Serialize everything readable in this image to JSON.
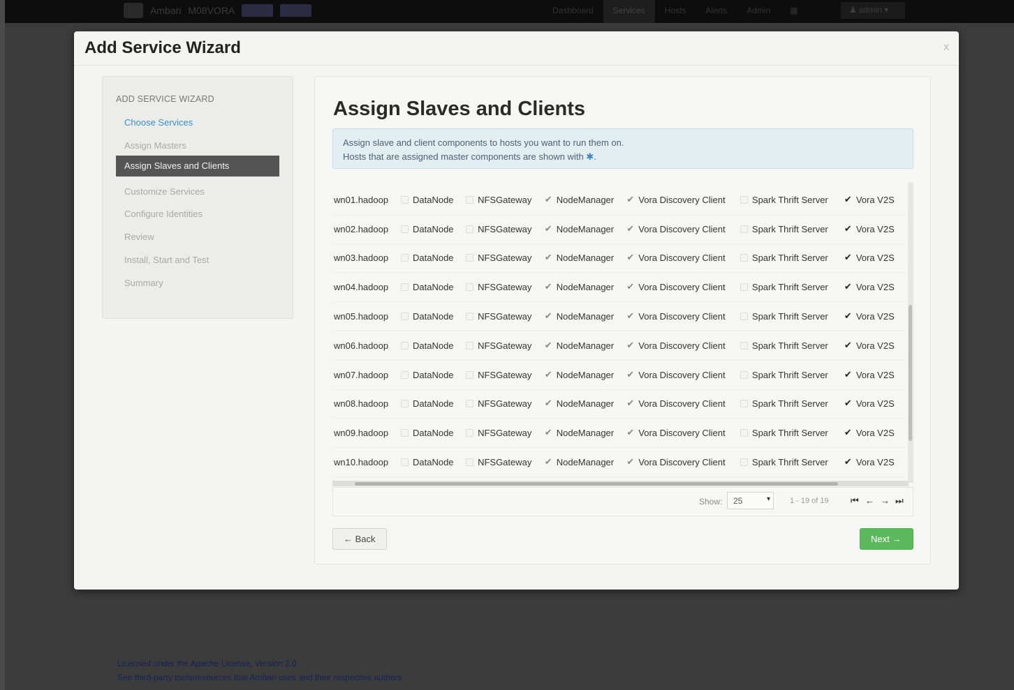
{
  "topbar": {
    "app_name": "Ambari",
    "cluster_name": "M08VORA",
    "nav": [
      "Dashboard",
      "Services",
      "Hosts",
      "Alerts",
      "Admin"
    ],
    "active_nav": "Services",
    "user": "admin"
  },
  "modal": {
    "title": "Add Service Wizard",
    "close": "x"
  },
  "sidebar": {
    "title": "ADD SERVICE WIZARD",
    "items": [
      {
        "label": "Choose Services",
        "state": "link"
      },
      {
        "label": "Assign Masters",
        "state": "disabled"
      },
      {
        "label": "Assign Slaves and Clients",
        "state": "active"
      },
      {
        "label": "Customize Services",
        "state": "disabled"
      },
      {
        "label": "Configure Identities",
        "state": "disabled"
      },
      {
        "label": "Review",
        "state": "disabled"
      },
      {
        "label": "Install, Start and Test",
        "state": "disabled"
      },
      {
        "label": "Summary",
        "state": "disabled"
      }
    ]
  },
  "content": {
    "title": "Assign Slaves and Clients",
    "alert_line1": "Assign slave and client components to hosts you want to run them on.",
    "alert_line2": "Hosts that are assigned master components are shown with",
    "alert_end": ".",
    "master_icon": "✱",
    "components": [
      "DataNode",
      "NFSGateway",
      "NodeManager",
      "Vora Discovery Client",
      "Spark Thrift Server",
      "Vora V2S"
    ],
    "rows": [
      {
        "host": "wn01.hadoop",
        "checked": [
          false,
          false,
          true,
          true,
          false,
          true
        ]
      },
      {
        "host": "wn02.hadoop",
        "checked": [
          false,
          false,
          true,
          true,
          false,
          true
        ]
      },
      {
        "host": "wn03.hadoop",
        "checked": [
          false,
          false,
          true,
          true,
          false,
          true
        ]
      },
      {
        "host": "wn04.hadoop",
        "checked": [
          false,
          false,
          true,
          true,
          false,
          true
        ]
      },
      {
        "host": "wn05.hadoop",
        "checked": [
          false,
          false,
          true,
          true,
          false,
          true
        ]
      },
      {
        "host": "wn06.hadoop",
        "checked": [
          false,
          false,
          true,
          true,
          false,
          true
        ]
      },
      {
        "host": "wn07.hadoop",
        "checked": [
          false,
          false,
          true,
          true,
          false,
          true
        ]
      },
      {
        "host": "wn08.hadoop",
        "checked": [
          false,
          false,
          true,
          true,
          false,
          true
        ]
      },
      {
        "host": "wn09.hadoop",
        "checked": [
          false,
          false,
          true,
          true,
          false,
          true
        ]
      },
      {
        "host": "wn10.hadoop",
        "checked": [
          false,
          false,
          true,
          true,
          false,
          true
        ]
      }
    ],
    "pager": {
      "show_label": "Show:",
      "show_value": "25",
      "range": "1 - 19 of 19",
      "first": "⏮",
      "prev": "←",
      "next": "→",
      "last": "⏭"
    },
    "back_label": "← Back",
    "next_label": "Next →"
  },
  "footer": {
    "line1": "Licensed under the Apache License, Version 2.0.",
    "line2": "See third-party tools/resources that Ambari uses and their respective authors"
  }
}
